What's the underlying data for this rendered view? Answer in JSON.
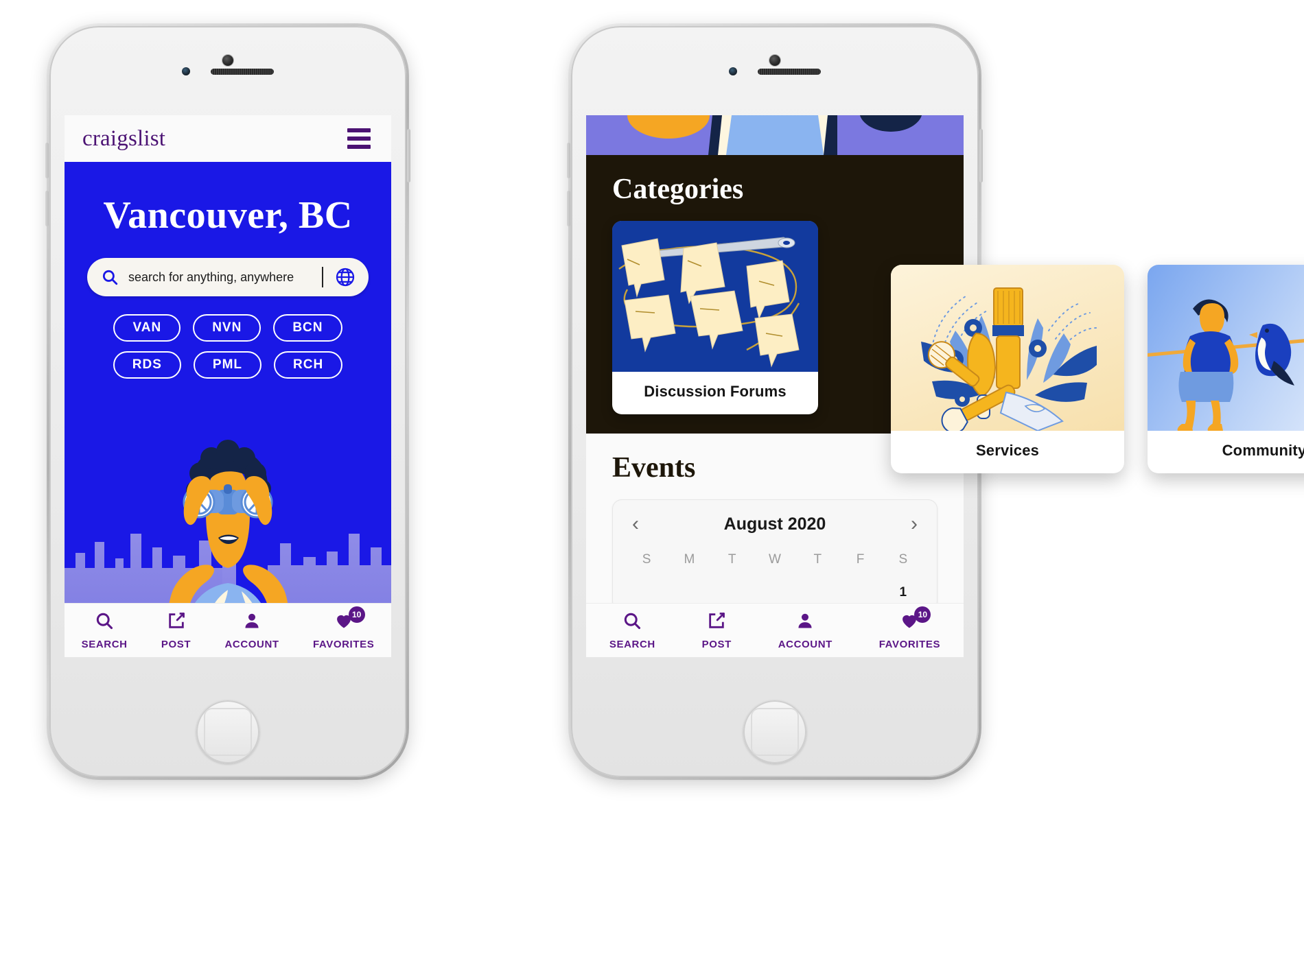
{
  "app": {
    "wordmark": "craigslist",
    "menu_icon": "hamburger-icon"
  },
  "colors": {
    "brand_purple": "#4b1273",
    "hero_blue": "#1a18e6",
    "nav_purple": "#5b1687",
    "dark": "#1d1609",
    "cream": "#f9e9c2"
  },
  "phone1": {
    "hero": {
      "title": "Vancouver, BC",
      "illustration": "person-with-binoculars-illustration"
    },
    "search": {
      "placeholder": "search for anything, anywhere",
      "search_icon": "search-icon",
      "globe_icon": "globe-icon"
    },
    "city_chips": [
      "VAN",
      "NVN",
      "BCN",
      "RDS",
      "PML",
      "RCH"
    ]
  },
  "phone2": {
    "categories": {
      "title": "Categories",
      "cards": [
        {
          "label": "Discussion Forums",
          "art": "needle-thread-speech-bubbles-illustration"
        },
        {
          "label": "Services",
          "art": "tool-bouquet-illustration"
        },
        {
          "label": "Community",
          "art": "person-and-birds-on-wire-illustration"
        }
      ]
    },
    "events": {
      "title": "Events",
      "calendar": {
        "month_label": "August 2020",
        "prev_icon": "chevron-left-icon",
        "next_icon": "chevron-right-icon",
        "day_initials": [
          "S",
          "M",
          "T",
          "W",
          "T",
          "F",
          "S"
        ],
        "first_week": [
          "",
          "",
          "",
          "",
          "",
          "",
          "1"
        ]
      }
    }
  },
  "tabbar": {
    "items": [
      {
        "label": "SEARCH",
        "icon": "search-icon",
        "badge": ""
      },
      {
        "label": "POST",
        "icon": "compose-icon",
        "badge": ""
      },
      {
        "label": "ACCOUNT",
        "icon": "person-icon",
        "badge": ""
      },
      {
        "label": "FAVORITES",
        "icon": "heart-icon",
        "badge": "10"
      }
    ]
  }
}
